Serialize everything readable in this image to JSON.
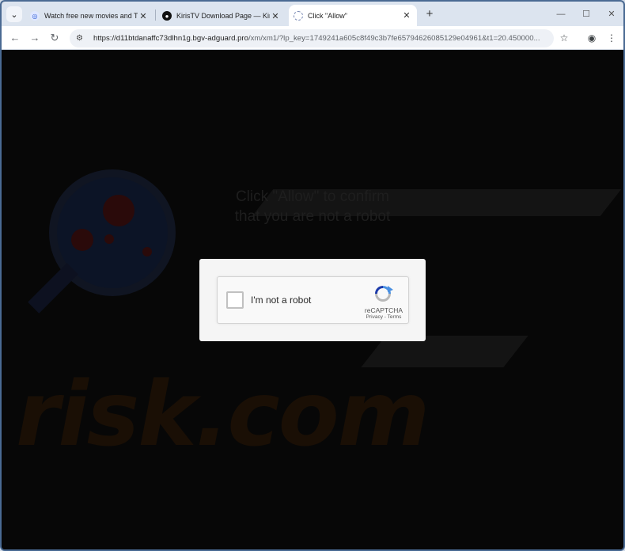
{
  "tabs": [
    {
      "title": "Watch free new movies and TV",
      "icon": "movie-site-icon",
      "active": false
    },
    {
      "title": "KirisTV Download Page — Kiris",
      "icon": "kiristv-icon",
      "active": false
    },
    {
      "title": "Click \"Allow\"",
      "icon": "loading-globe-icon",
      "active": true
    }
  ],
  "toolbar": {
    "url_host": "https://d11btdanaffc73dlhn1g.bgv-adguard.pro",
    "url_rest": "/xm/xm1/?lp_key=1749241a605c8f49c3b7fe65794626085129e04961&t1=20.450000..."
  },
  "page": {
    "prompt_line1": "Click \"Allow\" to confirm",
    "prompt_line2": "that you are not a robot",
    "watermark_text": "risk.com"
  },
  "recaptcha": {
    "label": "I'm not a robot",
    "brand": "reCAPTCHA",
    "privacy": "Privacy",
    "separator": " - ",
    "terms": "Terms"
  },
  "colors": {
    "frame": "#4a6a93",
    "tabstrip": "#dce4ef",
    "page_bg": "#070707",
    "recaptcha_blue": "#4a90e2"
  }
}
